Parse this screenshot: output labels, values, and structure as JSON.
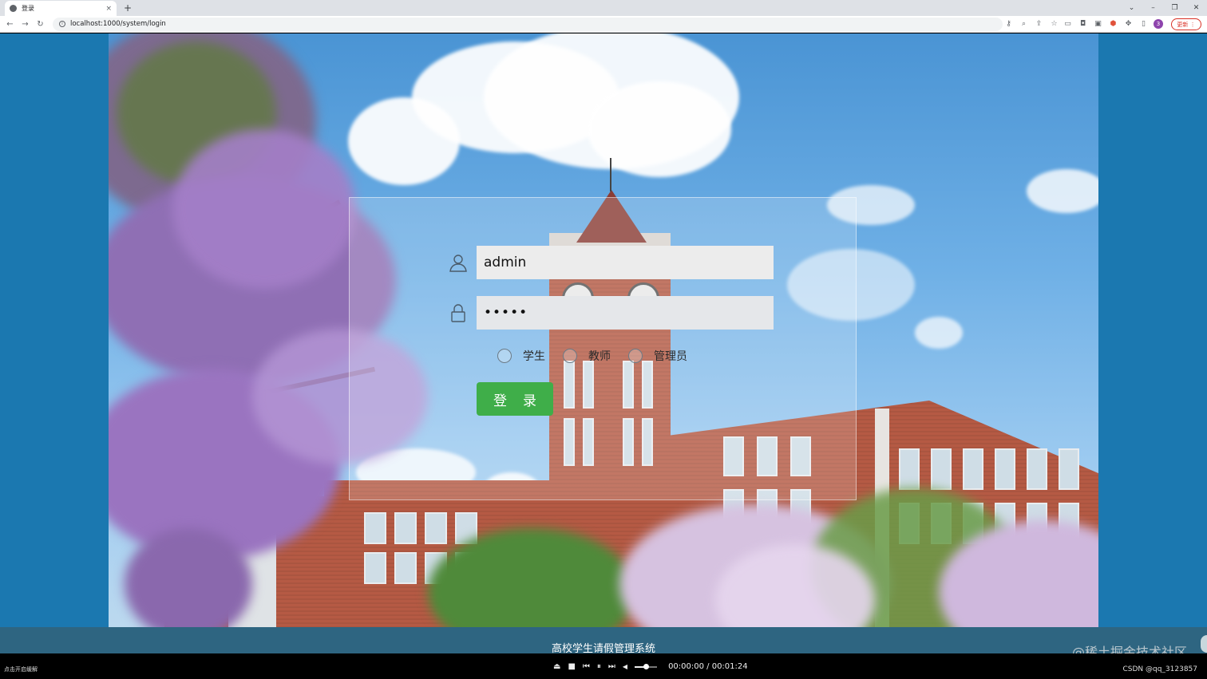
{
  "browser": {
    "tab_title": "登录",
    "tab_close": "×",
    "new_tab": "+",
    "url": "localhost:1000/system/login",
    "update_label": "更新",
    "profile_initial": "3"
  },
  "login": {
    "username": "admin",
    "password_mask": "•••••",
    "roles": [
      "学生",
      "教师",
      "管理员"
    ],
    "submit_label": "登录"
  },
  "footer": {
    "title": "高校学生请假管理系统",
    "watermark": "@稀土掘金技术社区"
  },
  "player": {
    "hint": "点击开启缓解",
    "time": "00:00:00 / 00:01:24",
    "volume_fraction": 0.5,
    "csdn_label": "CSDN @qq_3123857"
  },
  "colors": {
    "page_background": "#1b78b0",
    "footer_background": "#2e6581",
    "login_button": "#3fae49"
  },
  "icons": {
    "user_field": "user-icon",
    "password_field": "lock-icon"
  }
}
